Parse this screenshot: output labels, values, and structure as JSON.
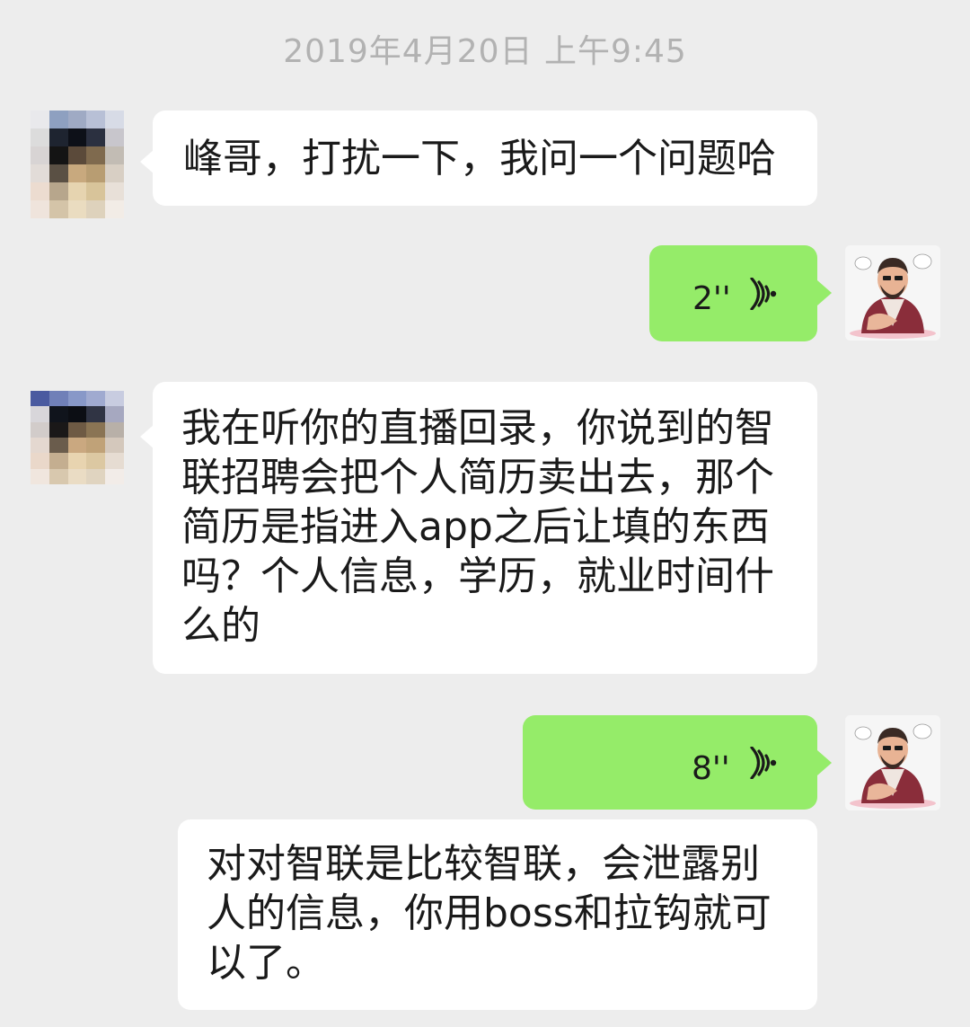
{
  "timestamp": "2019年4月20日 上午9:45",
  "messages": [
    {
      "side": "left",
      "type": "text",
      "text": "峰哥，打扰一下，我问一个问题哈"
    },
    {
      "side": "right",
      "type": "voice",
      "duration": "2''"
    },
    {
      "side": "left",
      "type": "text",
      "text": "我在听你的直播回录，你说到的智联招聘会把个人简历卖出去，那个简历是指进入app之后让填的东西吗？个人信息，学历，就业时间什么的"
    },
    {
      "side": "right",
      "type": "voice",
      "duration": "8''"
    },
    {
      "side": "right",
      "type": "text",
      "text": "对对智联是比较智联，会泄露别人的信息，你用boss和拉钩就可以了。"
    }
  ],
  "colors": {
    "background": "#ededed",
    "incoming_bubble": "#ffffff",
    "outgoing_bubble": "#95ec69",
    "timestamp_text": "#b2b2b2"
  },
  "icons": {
    "voice": "voice-wave-icon",
    "contact_avatar": "pixelated-avatar",
    "self_avatar": "cartoon-man-avatar"
  }
}
